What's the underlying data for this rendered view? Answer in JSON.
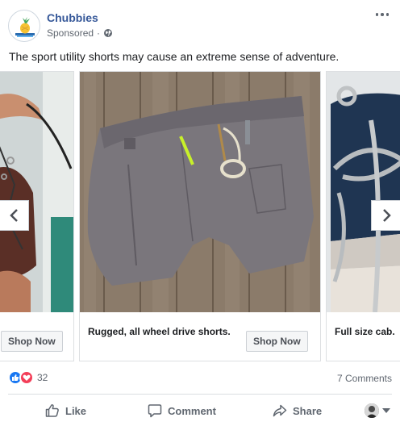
{
  "post": {
    "page_name": "Chubbies",
    "sponsored_label": "Sponsored",
    "sponsored_dot": "·",
    "text": "The sport utility shorts may cause an extreme sense of adventure."
  },
  "carousel": {
    "cards": [
      {
        "caption": "",
        "button_label": "Shop Now"
      },
      {
        "caption": "Rugged, all wheel drive shorts.",
        "button_label": "Shop Now"
      },
      {
        "caption": "Full size cab.",
        "button_label": ""
      }
    ]
  },
  "engagement": {
    "reaction_count": "32",
    "comments_label": "7 Comments"
  },
  "actions": {
    "like": "Like",
    "comment": "Comment",
    "share": "Share"
  },
  "colors": {
    "brand_blue": "#365899",
    "like_blue": "#1877f2",
    "love_red": "#f33e58"
  },
  "icons": [
    "globe-icon",
    "more-icon",
    "chevron-left-icon",
    "chevron-right-icon",
    "like-reaction-icon",
    "love-reaction-icon",
    "thumbs-up-icon",
    "comment-icon",
    "share-icon",
    "caret-down-icon"
  ]
}
